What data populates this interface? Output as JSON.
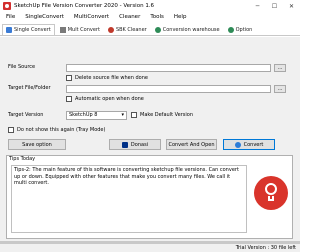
{
  "window": {
    "title": "SketchUp File Version Converter 2020 - Version 1.6",
    "minimize": "─",
    "maximize": "☐",
    "close": "✕"
  },
  "menu": [
    "File",
    "SingleConvert",
    "MultiConvert",
    "Cleaner",
    "Tools",
    "Help"
  ],
  "tabs": [
    {
      "label": "Single Convert",
      "active": true,
      "icon": "single-convert-icon"
    },
    {
      "label": "Mult Convert",
      "active": false,
      "icon": "multi-convert-icon"
    },
    {
      "label": "SBK Cleaner",
      "active": false,
      "icon": "sbk-cleaner-icon"
    },
    {
      "label": "Conversion warehouse",
      "active": false,
      "icon": "warehouse-icon"
    },
    {
      "label": "Option",
      "active": false,
      "icon": "option-icon"
    }
  ],
  "form": {
    "file_source_label": "File Source",
    "file_source_value": "",
    "browse_label": "...",
    "delete_source_label": "Delete source file when done",
    "target_folder_label": "Target File/Folder",
    "target_folder_value": "",
    "auto_open_label": "Automatic open when done",
    "target_version_label": "Target Version",
    "target_version_value": "SketchUp 8",
    "make_default_label": "Make Default Version",
    "do_not_show_label": "Do not show this again (Tray Mode)"
  },
  "buttons": {
    "save_option": "Save option",
    "donasi": "Donasi",
    "convert_and_open": "Convert And Open",
    "convert": "Convert"
  },
  "tips": {
    "title": "Tips Today",
    "text": "Tips-2: The main feature of this software is converting sketchup file versions. Can convert up or down. Equipped with other features that make you convert many files. We call it multi convert."
  },
  "status": {
    "text": "Trial Version : 30 file left"
  },
  "colors": {
    "accent": "#0078d7",
    "brand_red": "#d9342b"
  }
}
